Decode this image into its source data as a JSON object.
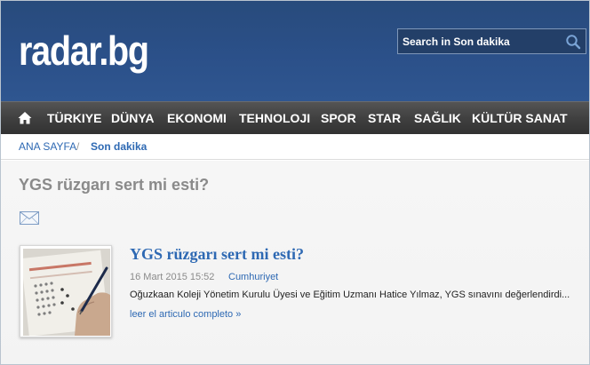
{
  "header": {
    "logo": "radar.bg",
    "search_placeholder": "Search in Son dakika"
  },
  "nav": {
    "home_icon": "home-icon",
    "items": [
      "TÜRKIYE",
      "DÜNYA",
      "EKONOMI",
      "TEHNOLOJI",
      "SPOR",
      "STAR",
      "SAĞLIK",
      "KÜLTÜR SANAT"
    ]
  },
  "breadcrumb": {
    "home": "ANA SAYFA",
    "separator": "/",
    "current": "Son dakika"
  },
  "page": {
    "title": "YGS rüzgarı sert mi esti?"
  },
  "article": {
    "title": "YGS rüzgarı sert mi esti?",
    "date": "16 Mart 2015 15:52",
    "source": "Cumhuriyet",
    "excerpt": "Oğuzkaan Koleji Yönetim Kurulu Üyesi ve Eğitim Uzmanı Hatice Yılmaz, YGS sınavını değerlendirdi...",
    "read_more": "leer el articulo completo »"
  },
  "colors": {
    "header_bg": "#2b5089",
    "nav_bg": "#404040",
    "link": "#2e69b3",
    "title_gray": "#8a8a8a"
  }
}
